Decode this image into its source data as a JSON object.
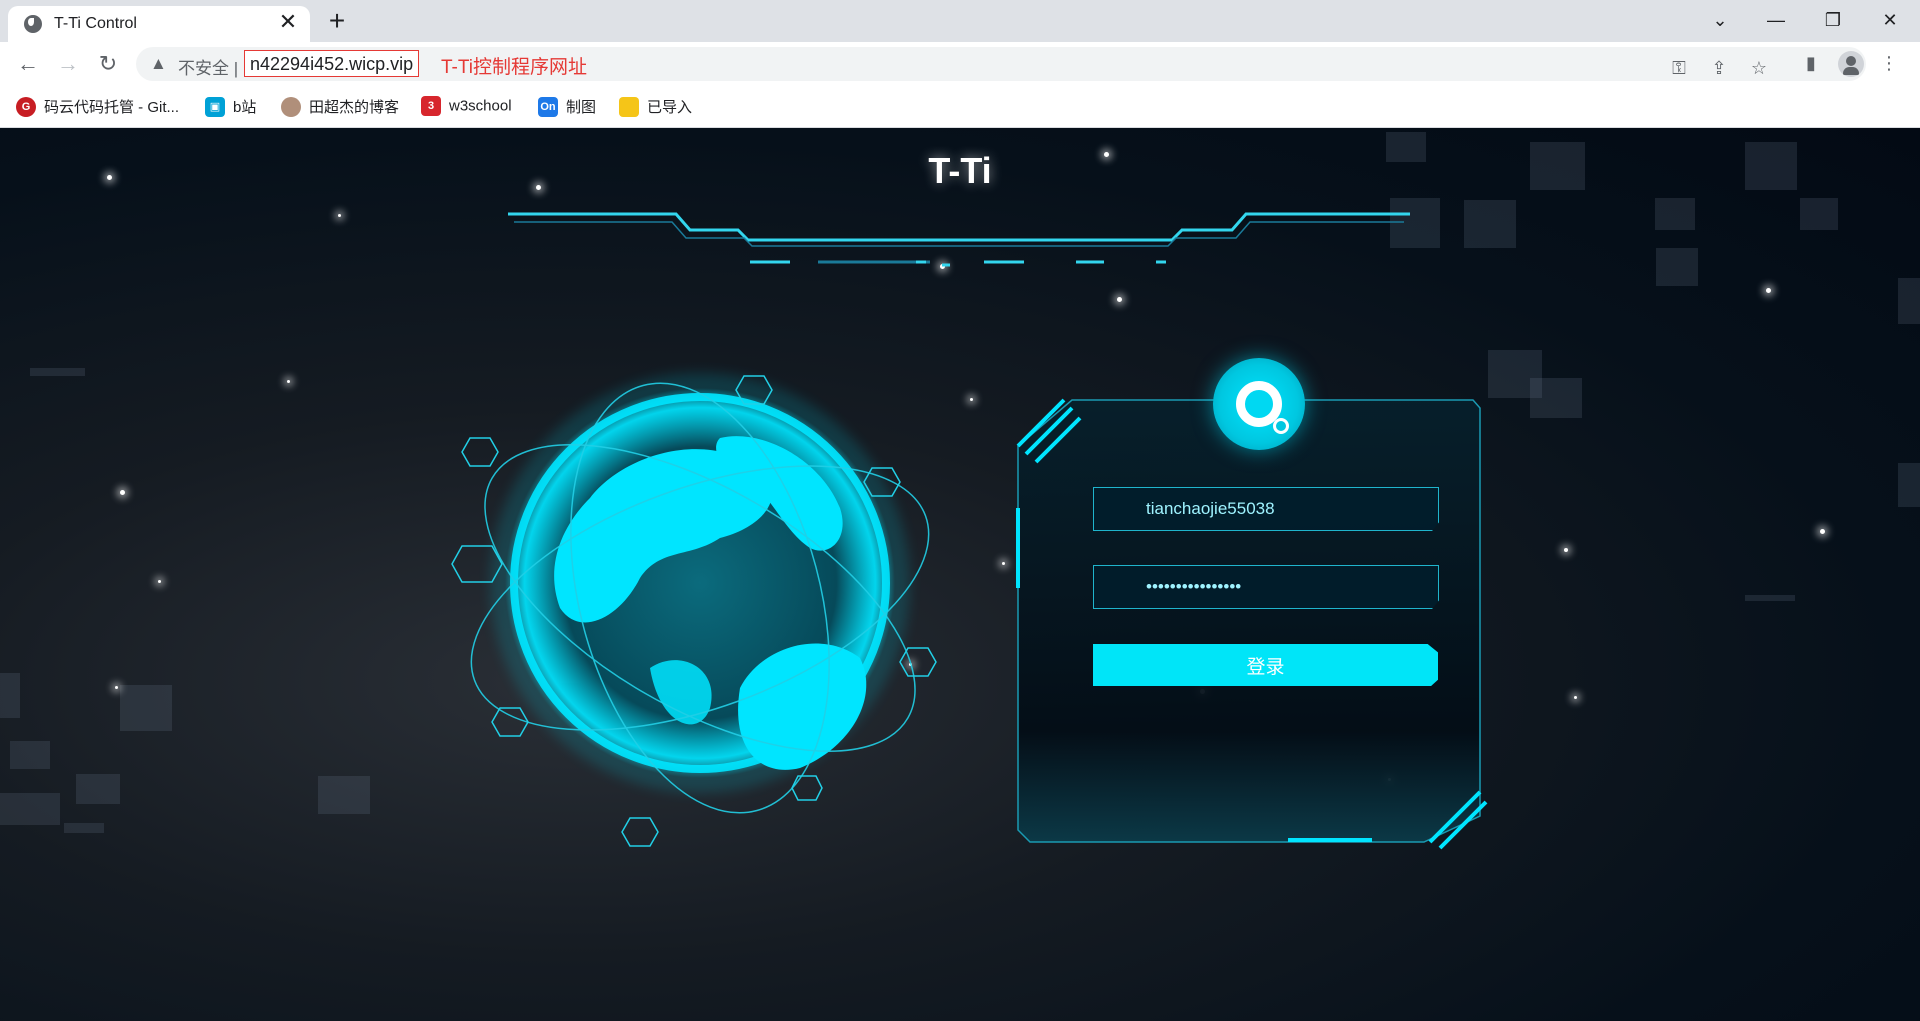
{
  "browser": {
    "tab_title": "T-Ti Control",
    "tab_close": "✕",
    "new_tab": "+",
    "window": {
      "minimize": "—",
      "restore": "❐",
      "close": "✕",
      "tabsearch": "⌄"
    },
    "nav": {
      "back": "←",
      "forward": "→",
      "reload": "↻"
    },
    "security_icon": "warning-triangle-icon",
    "security_text": "不安全 |",
    "url": "n42294i452.wicp.vip",
    "annotation": "T-Ti控制程序网址",
    "toolbar_icons": [
      "key-icon",
      "share-icon",
      "star-icon",
      "sidepanel-icon",
      "profile-icon",
      "menu-icon"
    ]
  },
  "bookmarks": [
    {
      "label": "码云代码托管 - Git...",
      "icon": "gitee-icon",
      "color": "#c71d23"
    },
    {
      "label": "b站",
      "icon": "bilibili-icon",
      "color": "#00a1d6"
    },
    {
      "label": "田超杰的博客",
      "icon": "avatar-icon",
      "color": "#b08f7a"
    },
    {
      "label": "w3school",
      "icon": "w3school-icon",
      "color": "#d7262d"
    },
    {
      "label": "制图",
      "icon": "processon-icon",
      "color": "#1e79e8"
    },
    {
      "label": "已导入",
      "icon": "folder-icon",
      "color": "#f5c518"
    }
  ],
  "page": {
    "title": "T-Ti",
    "username": "tianchaojie55038",
    "password": "••••••••••••••••",
    "login_label": "登录",
    "accent": "#00e5ff"
  }
}
